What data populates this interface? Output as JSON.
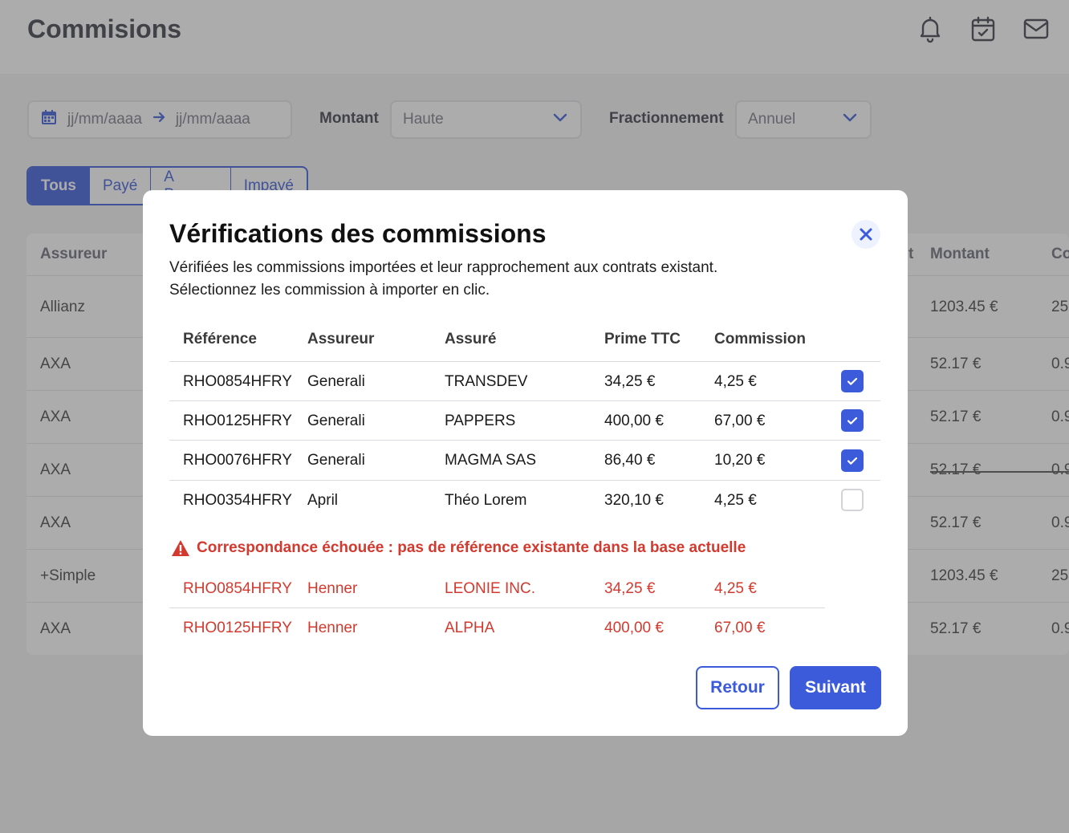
{
  "page": {
    "title": "Commisions",
    "icons": [
      "bell-icon",
      "calendar-check-icon",
      "mail-icon"
    ]
  },
  "filters": {
    "date_from_placeholder": "jj/mm/aaaa",
    "date_to_placeholder": "jj/mm/aaaa",
    "montant_label": "Montant",
    "montant_value": "Haute",
    "fractionnement_label": "Fractionnement",
    "fractionnement_value": "Annuel"
  },
  "status_tabs": [
    "Tous",
    "Payé",
    "A Payer",
    "Impayé"
  ],
  "background_table": {
    "headers": {
      "assureur": "Assureur",
      "col_t": "t",
      "montant": "Montant",
      "co": "Co"
    },
    "rows": [
      {
        "assureur": "Allianz",
        "montant": "1203.45 €",
        "extra": "25"
      },
      {
        "assureur": "AXA",
        "montant": "52.17 €",
        "extra": "0.9"
      },
      {
        "assureur": "AXA",
        "montant": "52.17 €",
        "extra": "0.9"
      },
      {
        "assureur": "AXA",
        "montant": "52.17 €",
        "extra": "0.9"
      },
      {
        "assureur": "AXA",
        "montant": "52.17 €",
        "extra": "0.9"
      },
      {
        "assureur": "+Simple",
        "montant": "1203.45 €",
        "extra": "25"
      },
      {
        "assureur": "AXA",
        "montant": "52.17 €",
        "extra": "0.9"
      }
    ]
  },
  "modal": {
    "title": "Vérifications des commissions",
    "description_line1": "Vérifiées les commissions importées et leur rapprochement aux contrats existant.",
    "description_line2": "Sélectionnez les commission à importer en clic.",
    "columns": {
      "reference": "Référence",
      "assureur": "Assureur",
      "assure": "Assuré",
      "prime": "Prime TTC",
      "commission": "Commission"
    },
    "rows": [
      {
        "reference": "RHO0854HFRY",
        "assureur": "Generali",
        "assure": "TRANSDEV",
        "prime": "34,25 €",
        "commission": "4,25 €",
        "checked": true
      },
      {
        "reference": "RHO0125HFRY",
        "assureur": "Generali",
        "assure": "PAPPERS",
        "prime": "400,00 €",
        "commission": "67,00 €",
        "checked": true
      },
      {
        "reference": "RHO0076HFRY",
        "assureur": "Generali",
        "assure": "MAGMA SAS",
        "prime": "86,40 €",
        "commission": "10,20 €",
        "checked": true
      },
      {
        "reference": "RHO0354HFRY",
        "assureur": "April",
        "assure": "Théo Lorem",
        "prime": "320,10 €",
        "commission": "4,25 €",
        "checked": false
      }
    ],
    "warning": "Correspondance échouée : pas de référence existante dans la base actuelle",
    "failed_rows": [
      {
        "reference": "RHO0854HFRY",
        "assureur": "Henner",
        "assure": "LEONIE INC.",
        "prime": "34,25 €",
        "commission": "4,25 €"
      },
      {
        "reference": "RHO0125HFRY",
        "assureur": "Henner",
        "assure": "ALPHA",
        "prime": "400,00 €",
        "commission": "67,00 €"
      }
    ],
    "back_label": "Retour",
    "next_label": "Suivant"
  },
  "colors": {
    "accent": "#3b5bdb",
    "error": "#d23a2f",
    "overlay": "rgba(70,70,70,0.45)"
  }
}
